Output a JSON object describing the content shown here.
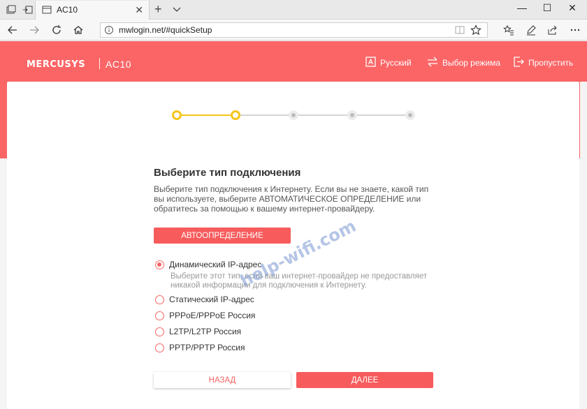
{
  "browser": {
    "tab_title": "AC10",
    "tab_close": "✕",
    "new_tab": "+",
    "address": "mwlogin.net/#quickSetup",
    "window_controls": [
      "—",
      "☐",
      "✕"
    ]
  },
  "header": {
    "logo": "MERCUSYS",
    "model": "AC10",
    "language": "Русский",
    "mode": "Выбор режима",
    "skip": "Пропустить"
  },
  "stepper": {
    "total_steps": 5,
    "current_step": 2
  },
  "main": {
    "title": "Выберите тип подключения",
    "description": "Выберите тип подключения к Интернету. Если вы не знаете, какой тип вы используете, выберите АВТОМАТИЧЕСКОЕ ОПРЕДЕЛЕНИЕ или обратитесь за помощью к вашему интернет-провайдеру.",
    "auto_button": "АВТООПРЕДЕЛЕНИЕ",
    "options": [
      {
        "label": "Динамический IP-адрес",
        "checked": true
      },
      {
        "label": "Статический IP-адрес",
        "checked": false
      },
      {
        "label": "PPPoE/PPPoE Россия",
        "checked": false
      },
      {
        "label": "L2TP/L2TP Россия",
        "checked": false
      },
      {
        "label": "PPTP/PPTP Россия",
        "checked": false
      }
    ],
    "dynamic_hint": "Выберите этот тип, если ваш интернет-провайдер не предоставляет никакой информации для подключения к Интернету.",
    "back_button": "НАЗАД",
    "next_button": "ДАЛЕЕ"
  },
  "watermark": "help-wifi.com",
  "colors": {
    "brand": "#fb6566",
    "accent": "#f75b5c",
    "step_active": "#f5c518",
    "step_inactive": "#cfcfcf"
  }
}
